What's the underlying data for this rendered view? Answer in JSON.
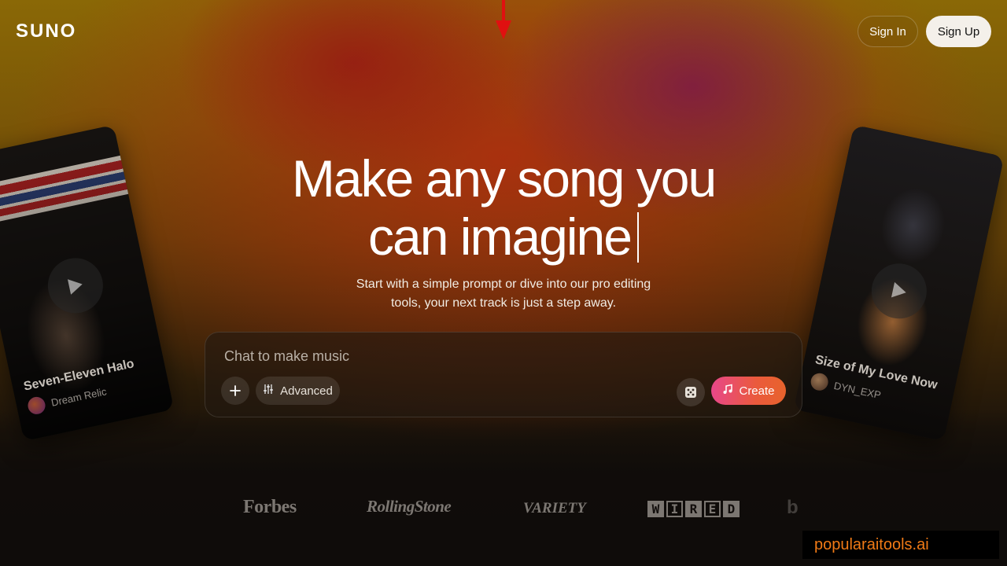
{
  "app": {
    "logo": "SUNO"
  },
  "nav": {
    "sign_in": "Sign In",
    "sign_up": "Sign Up"
  },
  "hero": {
    "headline_line1": "Make any song you",
    "headline_line2": "can imagine",
    "subtitle_line1": "Start with a simple prompt or dive into our pro editing",
    "subtitle_line2": "tools, your next track is just a step away."
  },
  "composer": {
    "placeholder": "Chat to make music",
    "value": "",
    "advanced_label": "Advanced",
    "create_label": "Create"
  },
  "cards": [
    {
      "title": "Seven-Eleven Halo",
      "artist": "Dream Relic"
    },
    {
      "title": "Size of My Love Now",
      "artist": "DYN_EXP"
    }
  ],
  "press": {
    "forbes": "Forbes",
    "rolling_stone": "RollingStone",
    "variety": "VARIETY",
    "wired_letters": [
      "W",
      "I",
      "R",
      "E",
      "D"
    ],
    "partial": "b"
  },
  "watermark": "popularaitools.ai",
  "colors": {
    "annotation_arrow": "#e01010",
    "create_gradient_start": "#e8478a",
    "create_gradient_end": "#e8632c",
    "watermark_text": "#f07a16"
  },
  "icons": {
    "annotation": "red-down-arrow-icon",
    "play": "play-icon",
    "plus": "plus-icon",
    "advanced": "sliders-icon",
    "random": "dice-icon",
    "create": "music-note-icon"
  }
}
